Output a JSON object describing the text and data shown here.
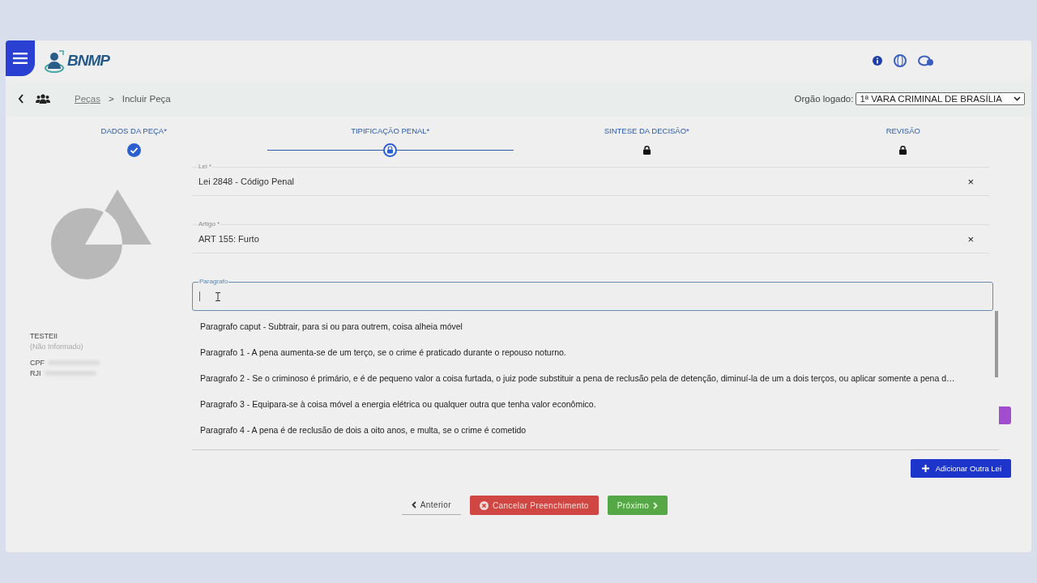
{
  "header": {
    "logo_text": "BNMP"
  },
  "breadcrumb": {
    "items": [
      {
        "label": "Peças",
        "link": true
      },
      {
        "label": "Incluir Peça",
        "link": false
      }
    ],
    "separator": ">"
  },
  "orgao": {
    "label": "Orgão logado:",
    "value": "1ª VARA CRIMINAL DE BRASÍLIA"
  },
  "steps": [
    {
      "label": "DADOS DA PEÇA*",
      "kind": "done"
    },
    {
      "label": "TIPIFICAÇÃO PENAL*",
      "kind": "current"
    },
    {
      "label": "SINTESE DA DECISÃO*",
      "kind": "locked"
    },
    {
      "label": "REVISÃO",
      "kind": "locked"
    }
  ],
  "person": {
    "name": "TESTEII",
    "subtitle": "(Não Informado)",
    "fields": [
      {
        "label": "CPF"
      },
      {
        "label": "RJI"
      }
    ]
  },
  "form": {
    "fields": [
      {
        "label": "Lei *",
        "value": "Lei 2848 - Código Penal",
        "clear": "×"
      },
      {
        "label": "Artigo *",
        "value": "ART 155: Furto",
        "clear": "×"
      },
      {
        "label": "Paragrafo",
        "focused": true
      }
    ],
    "options": [
      "Paragrafo caput - Subtrair, para si ou para outrem, coisa alheia móvel",
      "Paragrafo 1 - A pena aumenta-se de um terço, se o crime é praticado durante o repouso noturno.",
      "Paragrafo 2 - Se o criminoso é primário, e é de pequeno valor a coisa furtada, o juiz pode substituir a pena de reclusão pela de detenção, diminuí-la de um a dois terços, ou aplicar somente a pena d…",
      "Paragrafo 3 - Equipara-se à coisa móvel a energia elétrica ou qualquer outra que tenha valor econômico.",
      "Paragrafo 4 - A pena é de reclusão de dois a oito anos, e multa, se o crime é cometido"
    ],
    "add_button": "Adicionar Outra Lei"
  },
  "footer": {
    "back": "Anterior",
    "cancel": "Cancelar Preenchimento",
    "next": "Próximo"
  }
}
